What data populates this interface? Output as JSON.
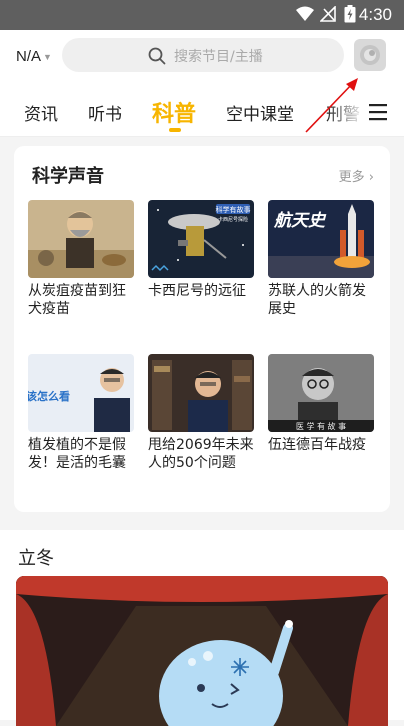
{
  "status_bar": {
    "time": "4:30"
  },
  "header": {
    "region": "N/A",
    "search_placeholder": "搜索节目/主播"
  },
  "tabs": [
    {
      "label": "资讯"
    },
    {
      "label": "听书"
    },
    {
      "label": "科普"
    },
    {
      "label": "空中课堂"
    },
    {
      "label": "刑警"
    }
  ],
  "active_tab": "科普",
  "section_science": {
    "title": "科学声音",
    "more_label": "更多",
    "items": [
      {
        "title": "从炭疽疫苗到狂犬疫苗"
      },
      {
        "title": "卡西尼号的远征",
        "thumb_text_top": "科学有故事",
        "thumb_text_sub": "卡西尼号探险"
      },
      {
        "title": "苏联人的火箭发展史",
        "thumb_text": "航天史"
      },
      {
        "title": "植发植的不是假发！是活的毛囊",
        "thumb_text": "该怎么看"
      },
      {
        "title": "甩给2069年未来人的50个问题"
      },
      {
        "title": "伍连德百年战疫",
        "thumb_text": "医 学 有 故 事"
      }
    ]
  },
  "section_season": {
    "title": "立冬"
  },
  "colors": {
    "accent": "#f7b500",
    "status_bar": "#5f5f5f",
    "annotation_arrow": "#e01010"
  }
}
